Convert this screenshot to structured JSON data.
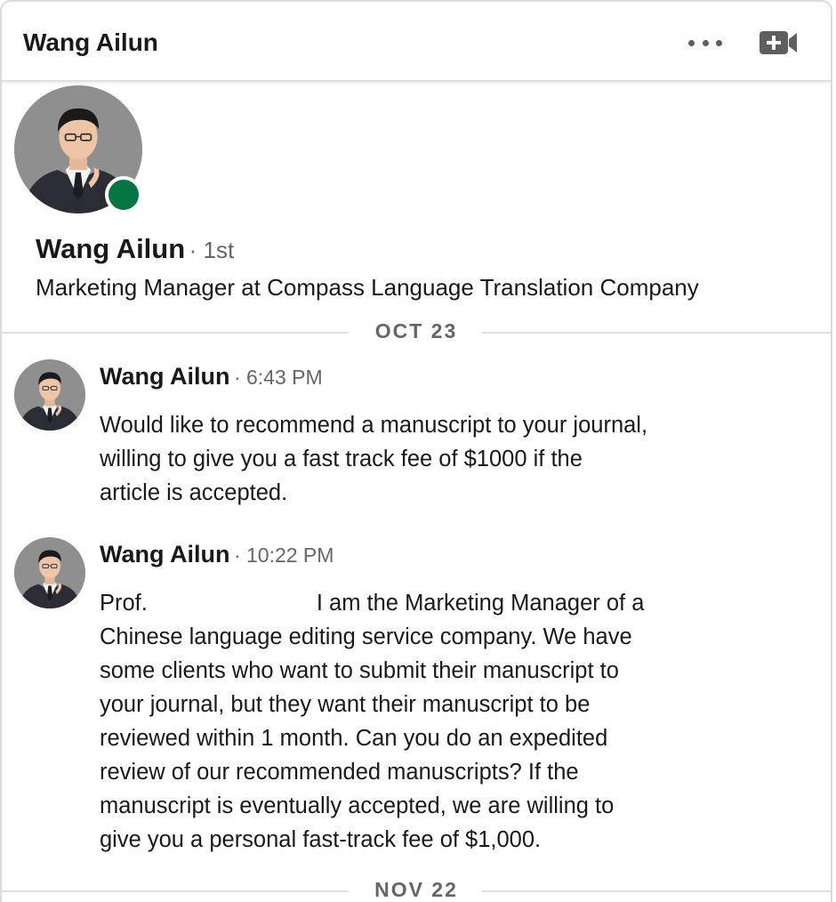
{
  "header": {
    "title": "Wang Ailun",
    "more_icon": "more-horizontal-icon",
    "video_icon": "video-call-add-icon"
  },
  "profile": {
    "name": "Wang Ailun",
    "degree": "· 1st",
    "headline": "Marketing Manager at Compass Language Translation Company",
    "status": "online",
    "status_color": "#057642"
  },
  "dividers": [
    {
      "label": "OCT 23"
    },
    {
      "label": "NOV 22"
    }
  ],
  "messages": [
    {
      "sender": "Wang Ailun",
      "time": "· 6:43 PM",
      "lines": [
        "Would like to recommend a manuscript to your journal,",
        "willing to give you a fast track fee of $1000 if the",
        "article is accepted."
      ]
    },
    {
      "sender": "Wang Ailun",
      "time": "· 10:22 PM",
      "first_line_start": "Prof.",
      "first_line_end": "I am the Marketing Manager of a",
      "lines": [
        "Chinese language editing service company. We have",
        "some clients who want to submit their manuscript to",
        "your journal, but they want their manuscript to be",
        "reviewed within 1 month. Can you do an expedited",
        "review of our recommended manuscripts? If the",
        "manuscript is eventually accepted, we are willing to",
        "give you a personal fast-track fee of $1,000."
      ]
    }
  ]
}
